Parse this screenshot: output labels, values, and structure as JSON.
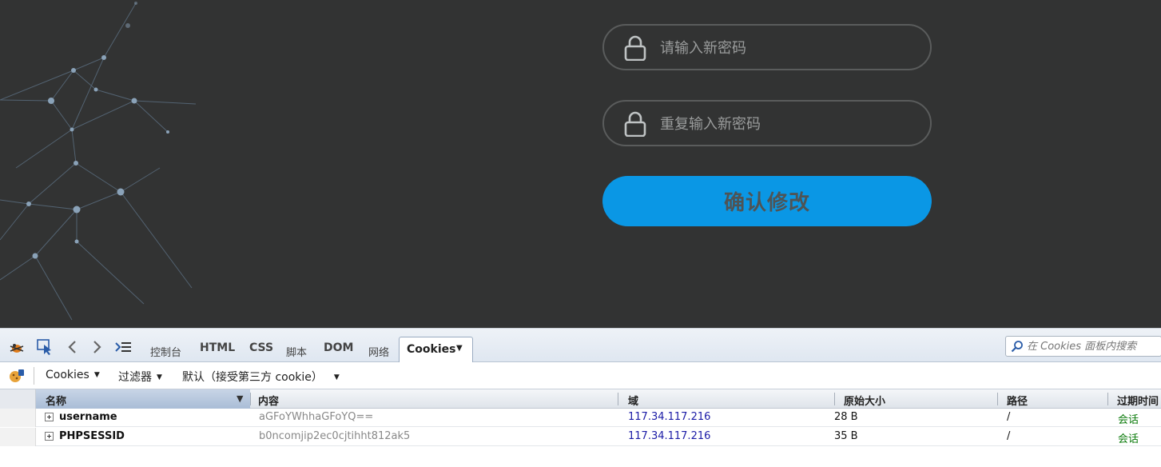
{
  "form": {
    "new_password_placeholder": "请输入新密码",
    "repeat_password_placeholder": "重复输入新密码",
    "confirm_label": "确认修改"
  },
  "devtools": {
    "tabs": [
      "控制台",
      "HTML",
      "CSS",
      "脚本",
      "DOM",
      "网络"
    ],
    "active_tab": "Cookies",
    "search_placeholder": "在 Cookies 面板内搜索",
    "toolbar": {
      "cookies_menu": "Cookies",
      "filter_menu": "过滤器",
      "policy_menu": "默认（接受第三方 cookie）"
    },
    "columns": [
      "名称",
      "内容",
      "域",
      "原始大小",
      "路径",
      "过期时间"
    ],
    "cookies": [
      {
        "name": "username",
        "value": "aGFoYWhhaGFoYQ==",
        "domain": "117.34.117.216",
        "size": "28 B",
        "path": "/",
        "expires": "会话"
      },
      {
        "name": "PHPSESSID",
        "value": "b0ncomjip2ec0cjtihht812ak5",
        "domain": "117.34.117.216",
        "size": "35 B",
        "path": "/",
        "expires": "会话"
      }
    ],
    "icons": [
      "firebug-icon",
      "inspect-icon",
      "back-icon",
      "forward-icon",
      "command-line-icon",
      "search-icon",
      "cookie-permissions-icon"
    ]
  },
  "colors": {
    "page_bg": "#323333",
    "button_bg": "#0a97e5",
    "domain_text": "#1a1aa6",
    "session_text": "#0a7a0a"
  }
}
